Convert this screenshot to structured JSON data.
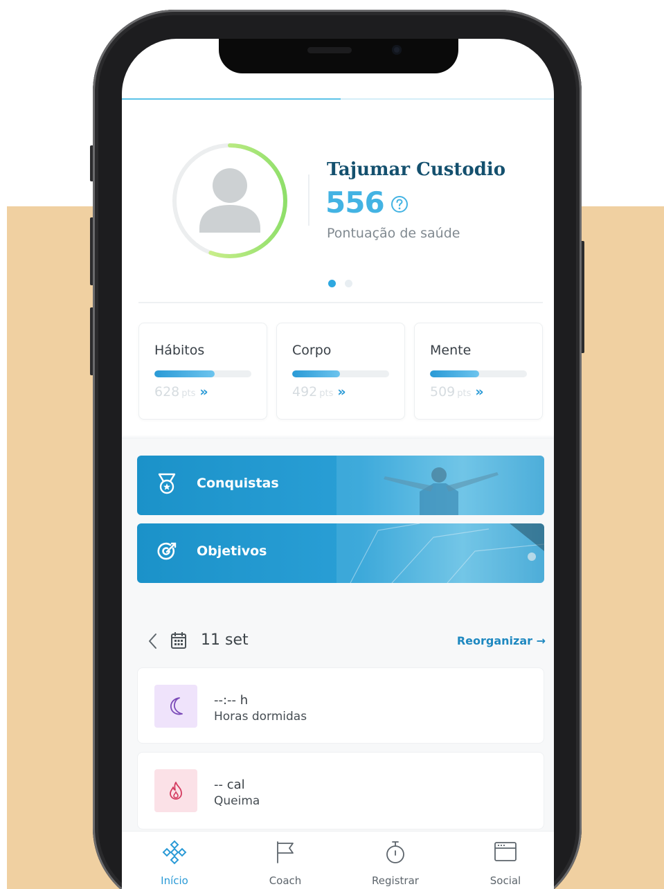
{
  "colors": {
    "background_accent": "#f0d0a1",
    "brand_blue": "#2a9ad6",
    "name_navy": "#14506e",
    "score_blue": "#43b3e3",
    "ring_green": "#9be36a"
  },
  "profile": {
    "name": "Tajumar Custodio",
    "score": "556",
    "score_label": "Pontuação de saúde",
    "ring_progress": 0.556,
    "carousel_active_index": 0,
    "carousel_count": 2
  },
  "categories": [
    {
      "title": "Hábitos",
      "points": "628",
      "unit": "pts",
      "arrow": "»",
      "progress": 0.62
    },
    {
      "title": "Corpo",
      "points": "492",
      "unit": "pts",
      "arrow": "»",
      "progress": 0.49
    },
    {
      "title": "Mente",
      "points": "509",
      "unit": "pts",
      "arrow": "»",
      "progress": 0.51
    }
  ],
  "banners": [
    {
      "label": "Conquistas",
      "icon": "medal-icon"
    },
    {
      "label": "Objetivos",
      "icon": "target-icon"
    }
  ],
  "date_row": {
    "date": "11 set",
    "reorganize_label": "Reorganizar →"
  },
  "metrics": [
    {
      "value": "--:-- h",
      "label": "Horas dormidas",
      "icon": "moon-icon"
    },
    {
      "value": "-- cal",
      "label": "Queima",
      "icon": "flame-icon"
    }
  ],
  "nav": [
    {
      "label": "Início",
      "icon": "home-flower-icon",
      "active": true
    },
    {
      "label": "Coach",
      "icon": "flag-icon",
      "active": false
    },
    {
      "label": "Registrar",
      "icon": "stopwatch-icon",
      "active": false
    },
    {
      "label": "Social",
      "icon": "browser-window-icon",
      "active": false
    }
  ]
}
